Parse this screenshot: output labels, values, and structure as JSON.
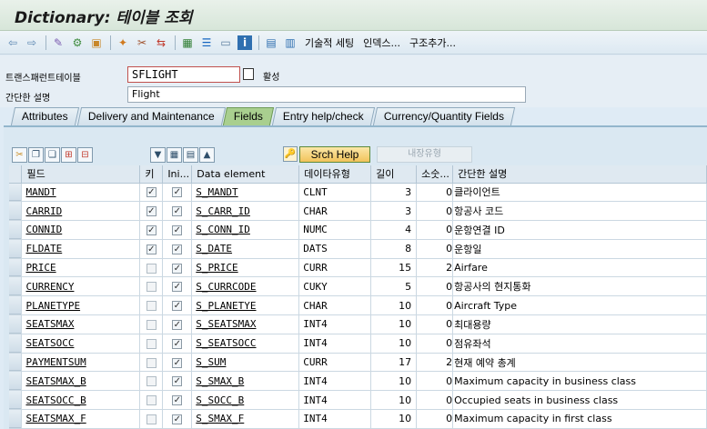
{
  "title": "Dictionary: 테이블 조회",
  "toolbar": {
    "text_buttons": [
      "기술적 세팅",
      "인덱스...",
      "구조추가..."
    ]
  },
  "header": {
    "name_label": "트랜스패런트테이블",
    "name_value": "SFLIGHT",
    "status": "활성",
    "desc_label": "간단한 설명",
    "desc_value": "Flight"
  },
  "tabs": [
    "Attributes",
    "Delivery and Maintenance",
    "Fields",
    "Entry help/check",
    "Currency/Quantity Fields"
  ],
  "active_tab": "Fields",
  "table_toolbar": {
    "srch_help": "Srch Help",
    "builtin_type": "내장유형"
  },
  "grid": {
    "columns": [
      "필드",
      "키",
      "Ini...",
      "Data element",
      "데이타유형",
      "길이",
      "소숫...",
      "간단한 설명"
    ],
    "rows": [
      {
        "field": "MANDT",
        "key": true,
        "init": true,
        "de": "S_MANDT",
        "type": "CLNT",
        "len": "3",
        "dec": "0",
        "desc": "클라이언트"
      },
      {
        "field": "CARRID",
        "key": true,
        "init": true,
        "de": "S_CARR_ID",
        "type": "CHAR",
        "len": "3",
        "dec": "0",
        "desc": "항공사 코드"
      },
      {
        "field": "CONNID",
        "key": true,
        "init": true,
        "de": "S_CONN_ID",
        "type": "NUMC",
        "len": "4",
        "dec": "0",
        "desc": "운항연결 ID"
      },
      {
        "field": "FLDATE",
        "key": true,
        "init": true,
        "de": "S_DATE",
        "type": "DATS",
        "len": "8",
        "dec": "0",
        "desc": "운항일"
      },
      {
        "field": "PRICE",
        "key": false,
        "init": true,
        "de": "S_PRICE",
        "type": "CURR",
        "len": "15",
        "dec": "2",
        "desc": "Airfare"
      },
      {
        "field": "CURRENCY",
        "key": false,
        "init": true,
        "de": "S_CURRCODE",
        "type": "CUKY",
        "len": "5",
        "dec": "0",
        "desc": "항공사의 현지통화"
      },
      {
        "field": "PLANETYPE",
        "key": false,
        "init": true,
        "de": "S_PLANETYE",
        "type": "CHAR",
        "len": "10",
        "dec": "0",
        "desc": "Aircraft Type"
      },
      {
        "field": "SEATSMAX",
        "key": false,
        "init": true,
        "de": "S_SEATSMAX",
        "type": "INT4",
        "len": "10",
        "dec": "0",
        "desc": "최대용량"
      },
      {
        "field": "SEATSOCC",
        "key": false,
        "init": true,
        "de": "S_SEATSOCC",
        "type": "INT4",
        "len": "10",
        "dec": "0",
        "desc": "점유좌석"
      },
      {
        "field": "PAYMENTSUM",
        "key": false,
        "init": true,
        "de": "S_SUM",
        "type": "CURR",
        "len": "17",
        "dec": "2",
        "desc": "현재 예약 총계"
      },
      {
        "field": "SEATSMAX_B",
        "key": false,
        "init": true,
        "de": "S_SMAX_B",
        "type": "INT4",
        "len": "10",
        "dec": "0",
        "desc": "Maximum capacity in business class"
      },
      {
        "field": "SEATSOCC_B",
        "key": false,
        "init": true,
        "de": "S_SOCC_B",
        "type": "INT4",
        "len": "10",
        "dec": "0",
        "desc": "Occupied seats in business class"
      },
      {
        "field": "SEATSMAX_F",
        "key": false,
        "init": true,
        "de": "S_SMAX_F",
        "type": "INT4",
        "len": "10",
        "dec": "0",
        "desc": "Maximum capacity in first class"
      }
    ]
  }
}
